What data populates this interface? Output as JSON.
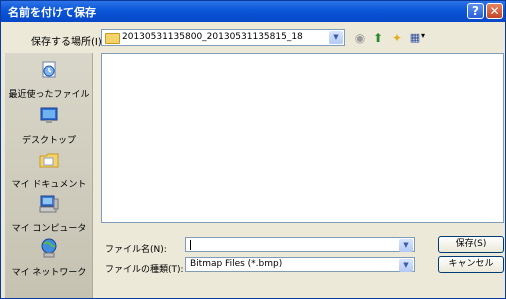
{
  "window": {
    "title": "名前を付けて保存",
    "help_glyph": "?",
    "close_glyph": "✕"
  },
  "location": {
    "label": "保存する場所(I):",
    "value": "20130531135800_20130531135815_18"
  },
  "toolbar": {
    "back_glyph": "◉",
    "up_glyph": "⬆",
    "new_folder_glyph": "✦",
    "views_glyph": "▦",
    "views_arrow": "▾"
  },
  "places": [
    {
      "label": "最近使ったファイル",
      "icon": "recent-documents-icon"
    },
    {
      "label": "デスクトップ",
      "icon": "desktop-icon"
    },
    {
      "label": "マイ ドキュメント",
      "icon": "my-documents-icon"
    },
    {
      "label": "マイ コンピュータ",
      "icon": "my-computer-icon"
    },
    {
      "label": "マイ ネットワーク",
      "icon": "my-network-icon"
    }
  ],
  "filename": {
    "label": "ファイル名(N):",
    "value": ""
  },
  "filetype": {
    "label": "ファイルの種類(T):",
    "value": "Bitmap Files (*.bmp)"
  },
  "buttons": {
    "save": "保存(S)",
    "cancel": "キャンセル"
  },
  "colors": {
    "titlebar": "#0a55d8",
    "dialog_bg": "#ece9d8",
    "field_border": "#7f9db9"
  }
}
